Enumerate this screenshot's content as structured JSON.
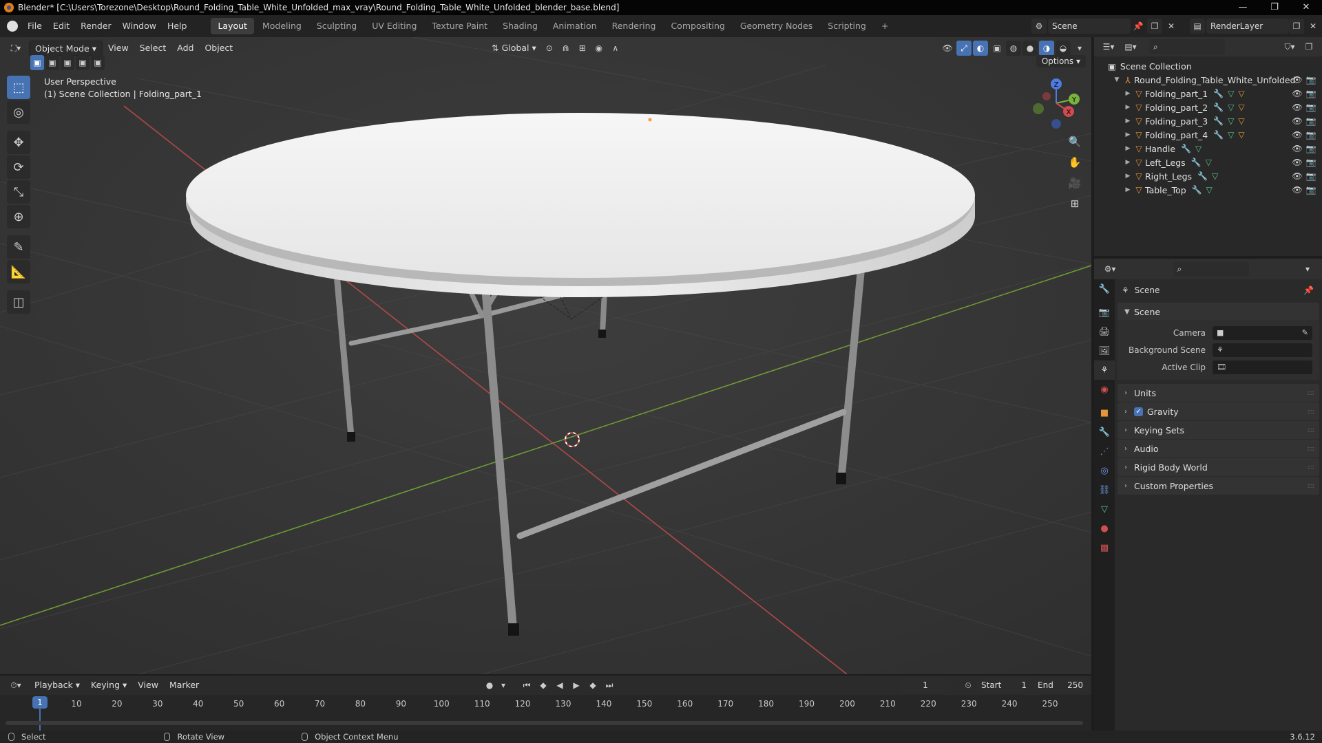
{
  "window": {
    "title": "Blender* [C:\\Users\\Torezone\\Desktop\\Round_Folding_Table_White_Unfolded_max_vray\\Round_Folding_Table_White_Unfolded_blender_base.blend]",
    "minimize": "—",
    "maximize": "❐",
    "close": "✕"
  },
  "menu": [
    "File",
    "Edit",
    "Render",
    "Window",
    "Help"
  ],
  "workspaces": [
    "Layout",
    "Modeling",
    "Sculpting",
    "UV Editing",
    "Texture Paint",
    "Shading",
    "Animation",
    "Rendering",
    "Compositing",
    "Geometry Nodes",
    "Scripting"
  ],
  "workspace_add": "+",
  "scene_field": "Scene",
  "renderlayer_field": "RenderLayer",
  "viewport": {
    "mode": "Object Mode",
    "menus": [
      "View",
      "Select",
      "Add",
      "Object"
    ],
    "transform_orientation": "Global",
    "options_label": "Options",
    "perspective": "User Perspective",
    "context": "(1) Scene Collection | Folding_part_1",
    "axis_x": "X",
    "axis_y": "Y",
    "axis_z": "Z"
  },
  "outliner": {
    "root": "Scene Collection",
    "collection": "Round_Folding_Table_White_Unfolded",
    "objects": [
      {
        "name": "Folding_part_1",
        "material": true
      },
      {
        "name": "Folding_part_2",
        "material": true
      },
      {
        "name": "Folding_part_3",
        "material": true
      },
      {
        "name": "Folding_part_4",
        "material": true
      },
      {
        "name": "Handle",
        "material": false
      },
      {
        "name": "Left_Legs",
        "material": false
      },
      {
        "name": "Right_Legs",
        "material": false
      },
      {
        "name": "Table_Top",
        "material": false
      }
    ]
  },
  "properties": {
    "context": "Scene",
    "section_title": "Scene",
    "fields": [
      {
        "label": "Camera"
      },
      {
        "label": "Background Scene"
      },
      {
        "label": "Active Clip"
      }
    ],
    "collapsed_sections": [
      "Units",
      "Gravity",
      "Keying Sets",
      "Audio",
      "Rigid Body World",
      "Custom Properties"
    ],
    "gravity_checked": true
  },
  "timeline": {
    "menus": [
      "Playback",
      "Keying",
      "View",
      "Marker"
    ],
    "current_frame": "1",
    "start_label": "Start",
    "start": "1",
    "end_label": "End",
    "end": "250",
    "ticks": [
      "10",
      "20",
      "30",
      "40",
      "50",
      "60",
      "70",
      "80",
      "90",
      "100",
      "110",
      "120",
      "130",
      "140",
      "150",
      "160",
      "170",
      "180",
      "190",
      "200",
      "210",
      "220",
      "230",
      "240",
      "250"
    ],
    "playhead_label": "1"
  },
  "statusbar": {
    "items": [
      "Select",
      "Rotate View",
      "Object Context Menu"
    ],
    "version": "3.6.12"
  },
  "colors": {
    "accent": "#4772b3",
    "object_icon": "#e8953a",
    "x_axis": "#c84a4a",
    "y_axis": "#7aa23c"
  }
}
